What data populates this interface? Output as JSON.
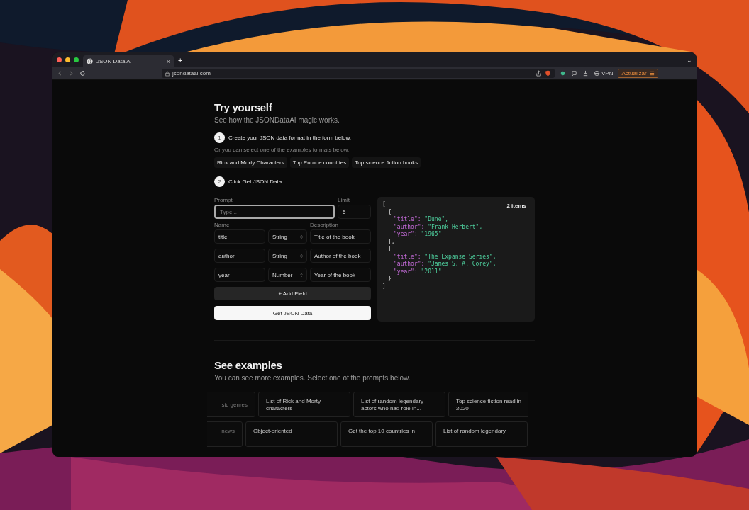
{
  "browser": {
    "tab": {
      "title": "JSON Data AI",
      "close": "×"
    },
    "new_tab": "+",
    "tab_menu": "⌄",
    "url": "jsondataai.com",
    "vpn": "VPN",
    "update_button": "Actualizar"
  },
  "try": {
    "title": "Try yourself",
    "subtitle": "See how the JSONDataAI magic works.",
    "step1": {
      "number": "1",
      "text": "Create your JSON data format in the form below."
    },
    "hint": "Or you can select one of the examples formats below.",
    "examples": [
      "Rick and Morty Characters",
      "Top Europe countries",
      "Top science fiction books"
    ],
    "step2": {
      "number": "2",
      "text": "Click Get JSON Data"
    }
  },
  "form": {
    "prompt_label": "Prompt",
    "prompt_placeholder": "Type...",
    "limit_label": "Limit",
    "limit_value": "5",
    "name_label": "Name",
    "description_label": "Description",
    "fields": [
      {
        "name": "title",
        "type": "String",
        "description": "Title of the book"
      },
      {
        "name": "author",
        "type": "String",
        "description": "Author of the book"
      },
      {
        "name": "year",
        "type": "Number",
        "description": "Year of the book"
      }
    ],
    "add_button": "+ Add Field",
    "submit_button": "Get JSON Data"
  },
  "output": {
    "count": "2 items",
    "open": "[",
    "close": "]",
    "children": [
      {
        "open": "{",
        "close": "},",
        "children": [
          {
            "key": "\"title\":",
            "value": "\"Dune\","
          },
          {
            "key": "\"author\":",
            "value": "\"Frank Herbert\","
          },
          {
            "key": "\"year\":",
            "value": "\"1965\""
          }
        ]
      },
      {
        "open": "{",
        "close": "}",
        "children": [
          {
            "key": "\"title\":",
            "value": "\"The Expanse Series\","
          },
          {
            "key": "\"author\":",
            "value": "\"James S. A. Corey\","
          },
          {
            "key": "\"year\":",
            "value": "\"2011\""
          }
        ]
      }
    ]
  },
  "examples_section": {
    "title": "See examples",
    "subtitle": "You can see more examples. Select one of the prompts below.",
    "rows": [
      [
        "sic genres",
        "List of Rick and Morty characters",
        "List of random legendary actors who had role in...",
        "Top science fiction read in 2020"
      ],
      [
        "news",
        "Object-oriented",
        "Get the top 10 countries in",
        "List of random legendary"
      ]
    ]
  }
}
